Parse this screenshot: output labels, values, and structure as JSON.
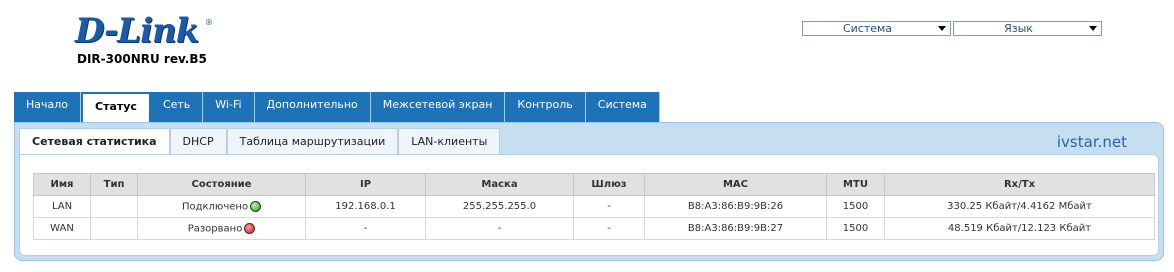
{
  "brand": {
    "logo": "D-Link",
    "model": "DIR-300NRU rev.B5"
  },
  "selects": {
    "system": {
      "value": "Система"
    },
    "language": {
      "value": "Язык"
    }
  },
  "main_tabs": [
    "Начало",
    "Статус",
    "Сеть",
    "Wi-Fi",
    "Дополнительно",
    "Межсетевой экран",
    "Контроль",
    "Система"
  ],
  "active_main_tab": "Статус",
  "sub_tabs": [
    "Сетевая статистика",
    "DHCP",
    "Таблица маршрутизации",
    "LAN-клиенты"
  ],
  "active_sub_tab": "Сетевая статистика",
  "watermark": "ivstar.net",
  "table": {
    "headers": [
      "Имя",
      "Тип",
      "Состояние",
      "IP",
      "Маска",
      "Шлюз",
      "MAC",
      "MTU",
      "Rx/Tx"
    ],
    "rows": [
      {
        "name": "LAN",
        "type": "",
        "state": "Подключено",
        "state_color": "#1fa01a",
        "ip": "192.168.0.1",
        "mask": "255.255.255.0",
        "gateway": "-",
        "mac": "B8:A3:86:B9:9B:26",
        "mtu": "1500",
        "rxtx": "330.25 Кбайт/4.4162 Мбайт"
      },
      {
        "name": "WAN",
        "type": "",
        "state": "Разорвано",
        "state_color": "#d11a1a",
        "ip": "-",
        "mask": "-",
        "gateway": "-",
        "mac": "B8:A3:86:B9:9B:27",
        "mtu": "1500",
        "rxtx": "48.519 Кбайт/12.123 Кбайт"
      }
    ]
  },
  "colors": {
    "tab_blue": "#1d72b8",
    "panel": "#c5dff1",
    "accent_text": "#2a63a8"
  }
}
